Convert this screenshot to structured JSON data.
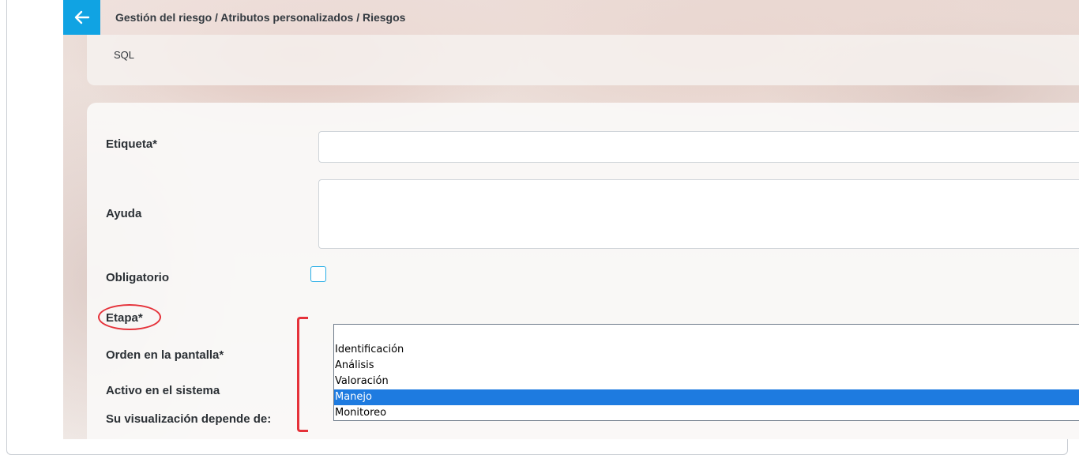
{
  "header": {
    "back_icon": "arrow-left-icon",
    "breadcrumb": "Gestión del riesgo / Atributos personalizados / Riesgos"
  },
  "sql_card": {
    "label": "SQL"
  },
  "form": {
    "etiqueta_label": "Etiqueta*",
    "etiqueta_value": "",
    "ayuda_label": "Ayuda",
    "ayuda_value": "",
    "obligatorio_label": "Obligatorio",
    "obligatorio_checked": false,
    "etapa_label": "Etapa*",
    "orden_label": "Orden en la pantalla*",
    "activo_label": "Activo en el sistema",
    "visualizacion_label": "Su visualización depende de:"
  },
  "etapa_options": [
    {
      "label": "",
      "selected": false
    },
    {
      "label": "Identificación",
      "selected": false
    },
    {
      "label": "Análisis",
      "selected": false
    },
    {
      "label": "Valoración",
      "selected": false
    },
    {
      "label": "Manejo",
      "selected": true
    },
    {
      "label": "Monitoreo",
      "selected": false
    }
  ],
  "colors": {
    "accent": "#10a3e3",
    "selection": "#1e7be0",
    "annotation": "#e5323a"
  }
}
